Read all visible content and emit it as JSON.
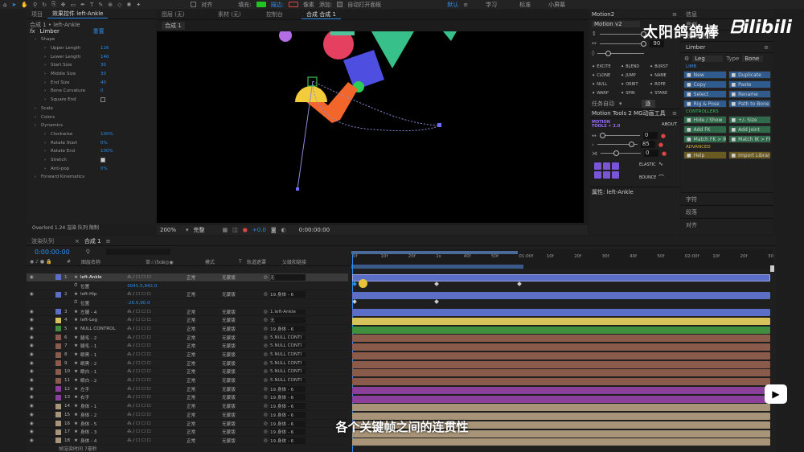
{
  "toolbar": {
    "snap_label": "对齐",
    "fill_label": "填充:",
    "stroke_label": "描边:",
    "px_label": "像素",
    "add_label": "添加:",
    "auto_open_label": "自动打开面板",
    "workspaces": [
      "默认",
      "学习",
      "标准",
      "小屏幕"
    ]
  },
  "left_panel": {
    "tabs": [
      "项目",
      "效果控件 left-Ankle"
    ],
    "breadcrumb": "合成 1 • left-Ankle",
    "fx_name": "Limber",
    "reset_label": "重置",
    "props": [
      {
        "name": "Shape",
        "value": ""
      },
      {
        "name": "Upper Length",
        "value": "116"
      },
      {
        "name": "Lower Length",
        "value": "140"
      },
      {
        "name": "Start Size",
        "value": "30"
      },
      {
        "name": "Middle Size",
        "value": "30"
      },
      {
        "name": "End Size",
        "value": "40"
      },
      {
        "name": "Bone Curvature",
        "value": "0"
      },
      {
        "name": "Square End",
        "value": ""
      },
      {
        "name": "Scale",
        "value": ""
      },
      {
        "name": "Colors",
        "value": ""
      },
      {
        "name": "Dynamics",
        "value": ""
      },
      {
        "name": "Clockwise",
        "value": "100%"
      },
      {
        "name": "Rotate Start",
        "value": "0%"
      },
      {
        "name": "Rotate End",
        "value": "100%"
      },
      {
        "name": "Stretch",
        "value": ""
      },
      {
        "name": "Anti-pop",
        "value": "0%"
      },
      {
        "name": "Forward Kinematics",
        "value": ""
      }
    ],
    "bottom_label": "Overlord  1.24 渲染 队列 限制"
  },
  "comp_tabs": [
    "图层 (无)",
    "素材 (无)",
    "控制台",
    "合成 合成 1"
  ],
  "comp_crumb": "合成 1",
  "viewer_bar": {
    "zoom": "200%",
    "quality": "完整",
    "exposure": "+0.0",
    "timecode": "0:00:00:00"
  },
  "motion2": {
    "title": "Motion2",
    "version": "Motion v2",
    "val1": "",
    "val2": "90",
    "tools": [
      "EXCITE",
      "BLEND",
      "BURST",
      "CLONE",
      "JUMP",
      "NAME",
      "NULL",
      "ORBIT",
      "ROPE",
      "WARP",
      "SPIN",
      "STARE"
    ],
    "task_label": "任务自动",
    "task_btn": "逐"
  },
  "mt2": {
    "title": "Motion Tools 2 MG动画工具",
    "logo": "MOTION TOOLS ✦ 2.0",
    "about": "ABOUT",
    "v1": "0",
    "v2": "85",
    "v3": "0",
    "elastic": "ELASTIC",
    "bounce": "BOUNCE"
  },
  "props_bar": "属性: left-Ankle",
  "right_panel": {
    "info": "信息",
    "audio": "音频",
    "fx_presets": "效果和预设",
    "limber": "Limber",
    "leg_label": "Leg",
    "type_label": "Type",
    "type_value": "Bone",
    "limb_label": "LIMB",
    "limb_btns": [
      "New",
      "Duplicate",
      "Copy",
      "Paste",
      "Select",
      "Rename",
      "Rig & Pose",
      "Path to Bone"
    ],
    "controllers_label": "CONTROLLERS",
    "ctrl_btns": [
      "Hide / Show",
      "+/- Size",
      "Add FK",
      "Add Joint",
      "Match FK > IK",
      "Match IK > FK"
    ],
    "advanced_label": "ADVANCED",
    "adv_btns": [
      "Help",
      "Import Library"
    ],
    "footer": [
      "字符",
      "段落",
      "对齐"
    ]
  },
  "watermark": "太阳鸽鸽棒",
  "timeline": {
    "tabs": [
      "渲染队列",
      "合成 1"
    ],
    "timecode": "0:00:00:00",
    "headers": [
      "#",
      "图层名称",
      "单☆\\fx⊞◎◉",
      "模式",
      "T",
      "轨道遮罩",
      "父级和链接"
    ],
    "ruler": [
      "0f",
      "10f",
      "20f",
      "1s",
      "40f",
      "50f",
      "01:00f",
      "10f",
      "20f",
      "30f",
      "40f",
      "50f",
      "02:00f",
      "10f",
      "20f",
      "30"
    ],
    "layers": [
      {
        "n": "1",
        "name": "left-Ankle",
        "mode": "正常",
        "mat": "无蒙版",
        "parent": "无",
        "color": "#5b6fc7",
        "sel": true
      },
      {
        "n": "",
        "name": "位置",
        "mode": "",
        "mat": "",
        "parent": "",
        "color": "",
        "sub": "3041.5,942.0"
      },
      {
        "n": "2",
        "name": "left-Hip",
        "mode": "正常",
        "mat": "无蒙版",
        "parent": "19.身体 - 6",
        "color": "#5b6fc7"
      },
      {
        "n": "",
        "name": "位置",
        "mode": "",
        "mat": "",
        "parent": "",
        "color": "",
        "sub": "-26.0,90.0"
      },
      {
        "n": "3",
        "name": "左腿 - 4",
        "mode": "正常",
        "mat": "无蒙版",
        "parent": "1.left-Ankle",
        "color": "#5b6fc7"
      },
      {
        "n": "4",
        "name": "left-Leg",
        "mode": "正常",
        "mat": "无蒙版",
        "parent": "无",
        "color": "#d6c45a"
      },
      {
        "n": "5",
        "name": "NULL CONTROL",
        "mode": "正常",
        "mat": "无蒙版",
        "parent": "19.身体 - 6",
        "color": "#3f8f3f"
      },
      {
        "n": "6",
        "name": "腿毛 - 2",
        "mode": "正常",
        "mat": "无蒙版",
        "parent": "5.NULL CONTI",
        "color": "#8a5a4a"
      },
      {
        "n": "7",
        "name": "腿毛 - 1",
        "mode": "正常",
        "mat": "无蒙版",
        "parent": "5.NULL CONTI",
        "color": "#8a5a4a"
      },
      {
        "n": "8",
        "name": "眼黑 - 1",
        "mode": "正常",
        "mat": "无蒙版",
        "parent": "5.NULL CONTI",
        "color": "#8a5a4a"
      },
      {
        "n": "9",
        "name": "眼黑 - 2",
        "mode": "正常",
        "mat": "无蒙版",
        "parent": "5.NULL CONTI",
        "color": "#8a5a4a"
      },
      {
        "n": "10",
        "name": "眼白 - 1",
        "mode": "正常",
        "mat": "无蒙版",
        "parent": "5.NULL CONTI",
        "color": "#8a5a4a"
      },
      {
        "n": "11",
        "name": "眼白 - 2",
        "mode": "正常",
        "mat": "无蒙版",
        "parent": "5.NULL CONTI",
        "color": "#8a5a4a"
      },
      {
        "n": "12",
        "name": "左手",
        "mode": "正常",
        "mat": "无蒙版",
        "parent": "19.身体 - 6",
        "color": "#8a3f9a"
      },
      {
        "n": "13",
        "name": "右手",
        "mode": "正常",
        "mat": "无蒙版",
        "parent": "19.身体 - 6",
        "color": "#8a3f9a"
      },
      {
        "n": "14",
        "name": "身体 - 1",
        "mode": "正常",
        "mat": "无蒙版",
        "parent": "19.身体 - 6",
        "color": "#a89478"
      },
      {
        "n": "15",
        "name": "身体 - 2",
        "mode": "正常",
        "mat": "无蒙版",
        "parent": "19.身体 - 6",
        "color": "#a89478"
      },
      {
        "n": "16",
        "name": "身体 - 5",
        "mode": "正常",
        "mat": "无蒙版",
        "parent": "19.身体 - 6",
        "color": "#a89478"
      },
      {
        "n": "17",
        "name": "身体 - 3",
        "mode": "正常",
        "mat": "无蒙版",
        "parent": "19.身体 - 6",
        "color": "#a89478"
      },
      {
        "n": "18",
        "name": "身体 - 4",
        "mode": "正常",
        "mat": "无蒙版",
        "parent": "19.身体 - 6",
        "color": "#a89478"
      }
    ],
    "footer": "帧渲染时间 7毫秒"
  },
  "subtitle": "各个关键帧之间的连贯性",
  "colors": {
    "accent": "#2d8ceb",
    "yellow_key": "#e8c33a"
  }
}
